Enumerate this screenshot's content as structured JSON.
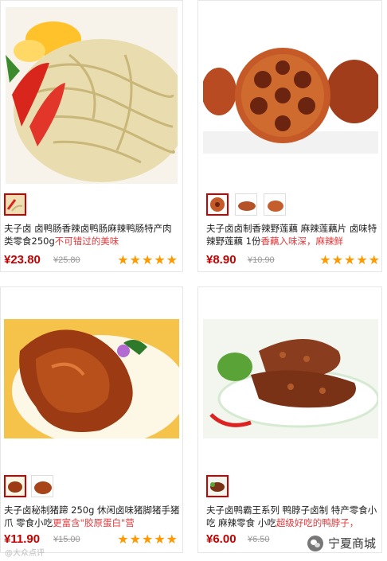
{
  "products": [
    {
      "title_plain": "夫子卤 卤鸭肠香辣卤鸭肠麻辣鸭肠特产肉类零食250g",
      "title_highlight": "不可错过的美味",
      "price": "¥23.80",
      "old_price": "¥25.80",
      "rating": 5
    },
    {
      "title_plain": "夫子卤卤制香辣野莲藕 麻辣莲藕片 卤味特辣野莲藕 1份",
      "title_highlight": "香藕入味深，麻辣鲜",
      "price": "¥8.90",
      "old_price": "¥10.90",
      "rating": 5
    },
    {
      "title_plain": "夫子卤秘制猪蹄 250g 休闲卤味猪脚猪手猪爪 零食小吃",
      "title_highlight": "更富含\"胶原蛋白\"营",
      "price": "¥11.90",
      "old_price": "¥15.00",
      "rating": 5
    },
    {
      "title_plain": "夫子卤鸭霸王系列 鸭脖子卤制 特产零食小吃 麻辣零食 小吃",
      "title_highlight": "超级好吃的鸭脖子，",
      "price": "¥6.00",
      "old_price": "¥6.50",
      "rating": 5
    }
  ],
  "watermark_left": "@大众点评",
  "watermark_right": "宁夏商城",
  "colors": {
    "price": "#c40000",
    "highlight": "#e4393c",
    "star": "#ff9900"
  }
}
